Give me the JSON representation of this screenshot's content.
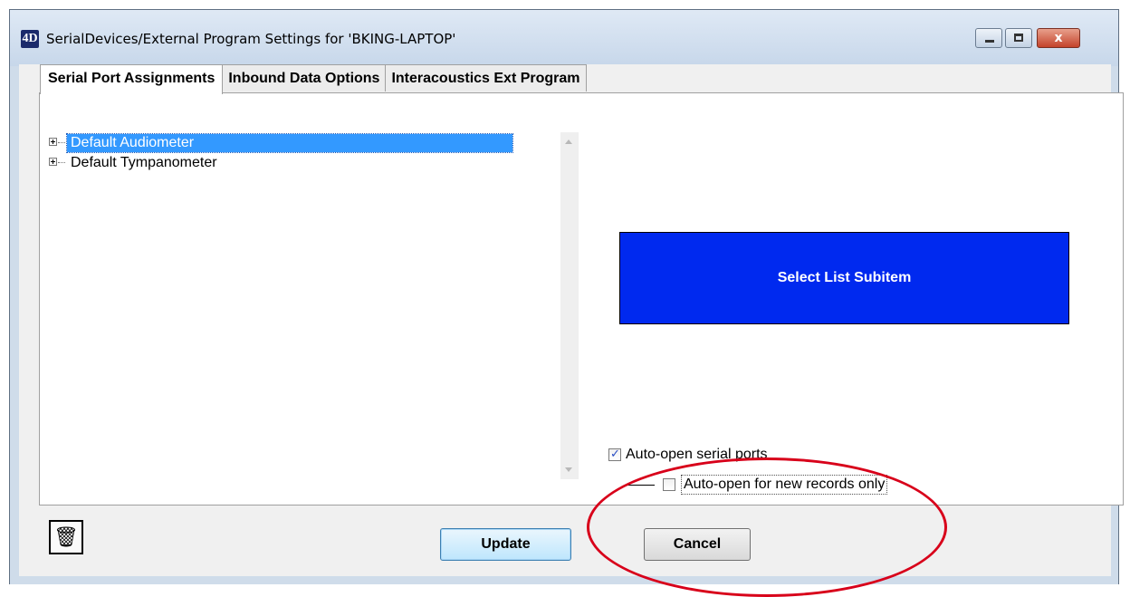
{
  "window": {
    "app_icon_glyph": "4D",
    "title": "SerialDevices/External Program Settings for 'BKING-LAPTOP'",
    "controls": {
      "minimize_icon": "minimize-icon",
      "maximize_icon": "maximize-icon",
      "close_glyph": "x"
    }
  },
  "tabs": [
    {
      "label": "Serial Port Assignments",
      "active": true
    },
    {
      "label": "Inbound Data Options",
      "active": false
    },
    {
      "label": "Interacoustics Ext Program",
      "active": false
    }
  ],
  "tree": {
    "items": [
      {
        "label": "Default Audiometer",
        "selected": true
      },
      {
        "label": "Default Tympanometer",
        "selected": false
      }
    ]
  },
  "banner": {
    "text": "Select List Subitem",
    "color": "#0029ef"
  },
  "options": {
    "auto_open_serial": {
      "label": "Auto-open serial ports",
      "checked": true
    },
    "auto_open_new_records": {
      "label": "Auto-open for new records only",
      "checked": false
    }
  },
  "buttons": {
    "update": "Update",
    "cancel": "Cancel",
    "trash_icon": "trash-icon"
  },
  "colors": {
    "selection": "#3399ff",
    "annotation": "#d8001a"
  }
}
